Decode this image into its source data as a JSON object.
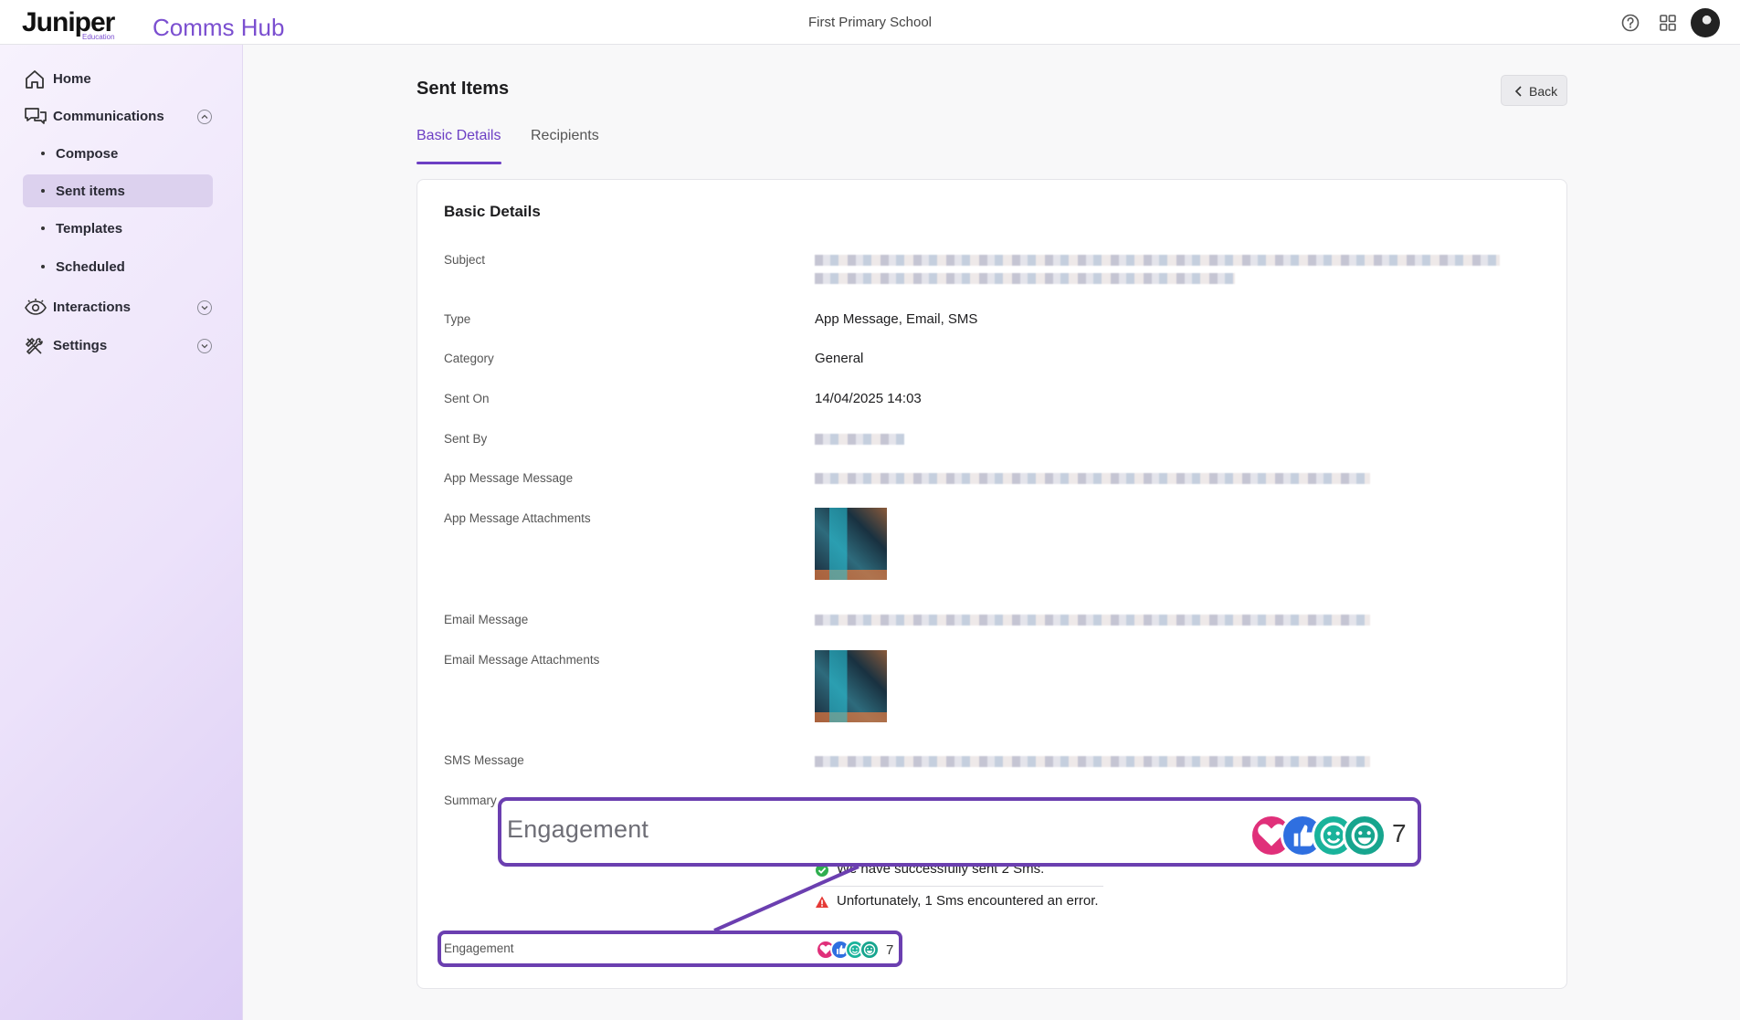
{
  "header": {
    "logo_text": "Juniper",
    "logo_sub": "Education",
    "app_name": "Comms Hub",
    "school_name": "First Primary School",
    "icons": [
      "help-icon",
      "apps-grid-icon",
      "avatar"
    ]
  },
  "sidebar": {
    "home": "Home",
    "communications": "Communications",
    "sub_items": [
      "Compose",
      "Sent items",
      "Templates",
      "Scheduled"
    ],
    "active_sub": "Sent items",
    "interactions": "Interactions",
    "settings": "Settings"
  },
  "page": {
    "title": "Sent Items",
    "back_label": "Back",
    "tabs": [
      "Basic Details",
      "Recipients"
    ],
    "active_tab": "Basic Details"
  },
  "details": {
    "card_title": "Basic Details",
    "labels": {
      "subject": "Subject",
      "type": "Type",
      "category": "Category",
      "sent_on": "Sent On",
      "sent_by": "Sent By",
      "app_message": "App Message Message",
      "app_attachments": "App Message Attachments",
      "email_message": "Email Message",
      "email_attachments": "Email Message Attachments",
      "sms_message": "SMS Message",
      "summary": "Summary",
      "engagement": "Engagement"
    },
    "values": {
      "type": "App Message, Email, SMS",
      "category": "General",
      "sent_on": "14/04/2025 14:03"
    },
    "summary": {
      "success_text": "We have successfully sent 2 Sms.",
      "error_text": "Unfortunately, 1 Sms encountered an error."
    }
  },
  "engagement": {
    "label": "Engagement",
    "count": "7",
    "reactions": [
      "heart-icon",
      "thumbs-up-icon",
      "smile-icon",
      "grin-icon"
    ],
    "colors": {
      "heart": "#e0307a",
      "thumbs_up": "#2f6fe0",
      "smile": "#19b39b",
      "grin": "#17a58e",
      "accent": "#6c3fc4"
    }
  }
}
